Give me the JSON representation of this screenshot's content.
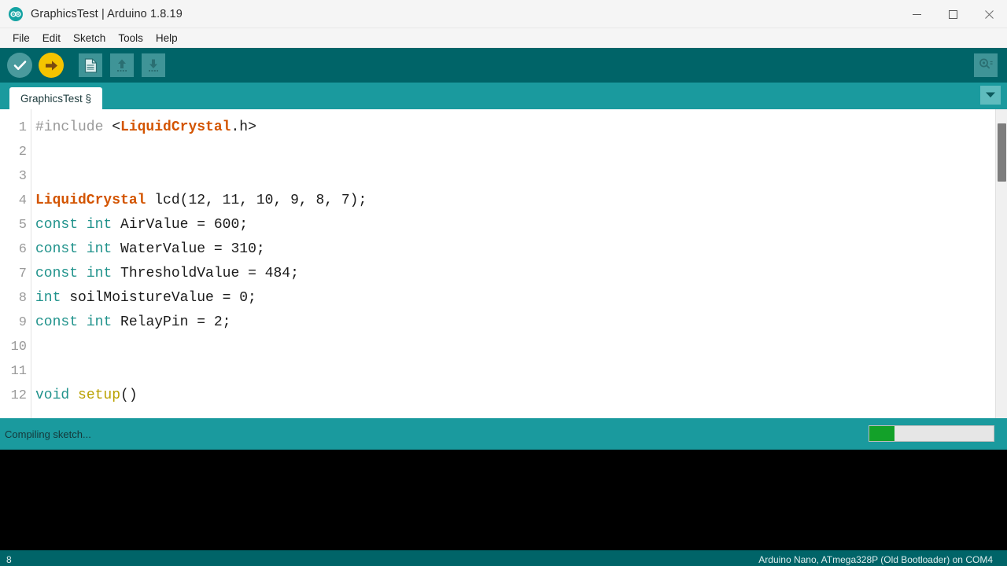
{
  "window": {
    "title": "GraphicsTest | Arduino 1.8.19",
    "logo_icon": "arduino-infinity-icon",
    "minimize_label": "Minimize",
    "maximize_label": "Maximize",
    "close_label": "Close"
  },
  "menubar": {
    "items": [
      {
        "label": "File"
      },
      {
        "label": "Edit"
      },
      {
        "label": "Sketch"
      },
      {
        "label": "Tools"
      },
      {
        "label": "Help"
      }
    ]
  },
  "toolbar": {
    "buttons": [
      {
        "name": "verify-button",
        "icon": "checkmark-icon",
        "label": "Verify"
      },
      {
        "name": "upload-button",
        "icon": "right-arrow-icon",
        "label": "Upload"
      },
      {
        "name": "new-button",
        "icon": "new-document-icon",
        "label": "New"
      },
      {
        "name": "open-button",
        "icon": "up-arrow-icon",
        "label": "Open"
      },
      {
        "name": "save-button",
        "icon": "down-arrow-icon",
        "label": "Save"
      }
    ],
    "serial_monitor": {
      "icon": "magnifier-icon",
      "label": "Serial Monitor"
    }
  },
  "tabs": {
    "items": [
      {
        "label": "GraphicsTest §",
        "active": true
      }
    ],
    "menu_icon": "chevron-down-icon",
    "menu_label": "Tab menu"
  },
  "editor": {
    "line_numbers": [
      "1",
      "2",
      "3",
      "4",
      "5",
      "6",
      "7",
      "8",
      "9",
      "10",
      "11",
      "12"
    ],
    "lines": [
      {
        "n": 1,
        "tokens": [
          {
            "t": "#include ",
            "c": "tok-pre"
          },
          {
            "t": "<",
            "c": "tok-plain"
          },
          {
            "t": "LiquidCrystal",
            "c": "tok-type"
          },
          {
            "t": ".h>",
            "c": "tok-plain"
          }
        ]
      },
      {
        "n": 2,
        "tokens": []
      },
      {
        "n": 3,
        "tokens": []
      },
      {
        "n": 4,
        "tokens": [
          {
            "t": "LiquidCrystal",
            "c": "tok-type"
          },
          {
            "t": " lcd(12, 11, 10, 9, 8, 7);",
            "c": "tok-plain"
          }
        ]
      },
      {
        "n": 5,
        "tokens": [
          {
            "t": "const",
            "c": "tok-kw"
          },
          {
            "t": " ",
            "c": "tok-plain"
          },
          {
            "t": "int",
            "c": "tok-kw"
          },
          {
            "t": " AirValue = 600;",
            "c": "tok-plain"
          }
        ]
      },
      {
        "n": 6,
        "tokens": [
          {
            "t": "const",
            "c": "tok-kw"
          },
          {
            "t": " ",
            "c": "tok-plain"
          },
          {
            "t": "int",
            "c": "tok-kw"
          },
          {
            "t": " WaterValue = 310;",
            "c": "tok-plain"
          }
        ]
      },
      {
        "n": 7,
        "tokens": [
          {
            "t": "const",
            "c": "tok-kw"
          },
          {
            "t": " ",
            "c": "tok-plain"
          },
          {
            "t": "int",
            "c": "tok-kw"
          },
          {
            "t": " ThresholdValue = 484;",
            "c": "tok-plain"
          }
        ]
      },
      {
        "n": 8,
        "tokens": [
          {
            "t": "int",
            "c": "tok-kw"
          },
          {
            "t": " soilMoistureValue = 0;",
            "c": "tok-plain"
          }
        ]
      },
      {
        "n": 9,
        "tokens": [
          {
            "t": "const",
            "c": "tok-kw"
          },
          {
            "t": " ",
            "c": "tok-plain"
          },
          {
            "t": "int",
            "c": "tok-kw"
          },
          {
            "t": " RelayPin = 2;",
            "c": "tok-plain"
          }
        ]
      },
      {
        "n": 10,
        "tokens": []
      },
      {
        "n": 11,
        "tokens": []
      },
      {
        "n": 12,
        "tokens": [
          {
            "t": "void",
            "c": "tok-kw"
          },
          {
            "t": " ",
            "c": "tok-plain"
          },
          {
            "t": "setup",
            "c": "tok-fn"
          },
          {
            "t": "()",
            "c": "tok-plain"
          }
        ]
      }
    ],
    "plain_text": "#include <LiquidCrystal.h>\n\n\nLiquidCrystal lcd(12, 11, 10, 9, 8, 7);\nconst int AirValue = 600;\nconst int WaterValue = 310;\nconst int ThresholdValue = 484;\nint soilMoistureValue = 0;\nconst int RelayPin = 2;\n\n\nvoid setup()"
  },
  "status": {
    "message": "Compiling sketch...",
    "progress_percent": 20
  },
  "console": {
    "text": ""
  },
  "bottombar": {
    "line_number": "8",
    "board_info": "Arduino Nano, ATmega328P (Old Bootloader) on COM4"
  },
  "colors": {
    "toolbar_bg": "#006468",
    "tabbar_bg": "#1a9a9e",
    "upload_accent": "#f5c400",
    "progress_green": "#13a129",
    "keyword_teal": "#21938c",
    "type_orange": "#d35400",
    "function_yellow": "#b9a100"
  }
}
